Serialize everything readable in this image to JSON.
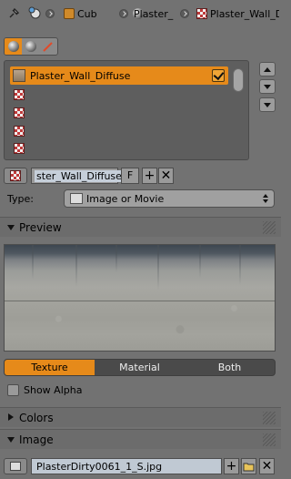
{
  "breadcrumb": {
    "items": [
      {
        "label": "Cub",
        "icon": "cube-icon"
      },
      {
        "label": "Plaster_",
        "icon": "material-sphere-icon"
      },
      {
        "label": "Plaster_Wall_D",
        "icon": "checker-texture-icon"
      }
    ]
  },
  "texture_context_tabs": [
    "world-icon",
    "material-icon",
    "brush-icon"
  ],
  "texture_slots": {
    "selected": {
      "label": "Plaster_Wall_Diffuse",
      "enabled": true
    },
    "empty_slots": 4
  },
  "texture_datablock": {
    "name": "ster_Wall_Diffuse",
    "fake_user_label": "F",
    "add_icon": "plus-icon",
    "remove_icon": "close-icon"
  },
  "type_row": {
    "label": "Type:",
    "value": "Image or Movie"
  },
  "panels": {
    "preview": "Preview",
    "colors": "Colors",
    "image": "Image"
  },
  "preview_tabs": {
    "options": [
      "Texture",
      "Material",
      "Both"
    ],
    "active": "Texture"
  },
  "show_alpha": {
    "label": "Show Alpha",
    "checked": false
  },
  "image": {
    "filename": "PlasterDirty0061_1_S.jpg"
  },
  "colors": {
    "accent": "#e68a1a",
    "panel_bg": "#727272",
    "field_bg": "#9a9a9a"
  }
}
